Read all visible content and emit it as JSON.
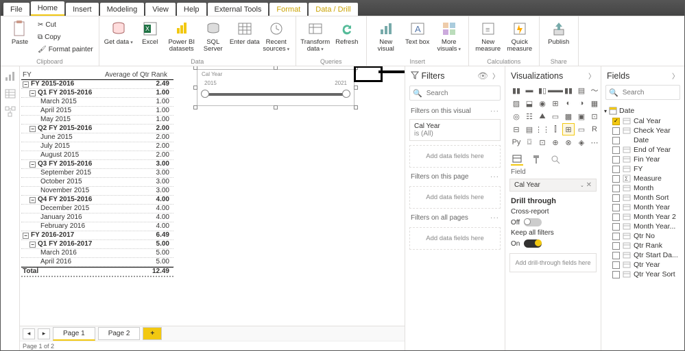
{
  "menu": {
    "file": "File",
    "home": "Home",
    "insert": "Insert",
    "modeling": "Modeling",
    "view": "View",
    "help": "Help",
    "ext": "External Tools",
    "format": "Format",
    "drill": "Data / Drill"
  },
  "ribbon": {
    "clipboard": {
      "paste": "Paste",
      "cut": "Cut",
      "copy": "Copy",
      "fp": "Format painter",
      "label": "Clipboard"
    },
    "data": {
      "get": "Get data",
      "excel": "Excel",
      "pbi": "Power BI datasets",
      "sql": "SQL Server",
      "enter": "Enter data",
      "recent": "Recent sources",
      "label": "Data"
    },
    "queries": {
      "transform": "Transform data",
      "refresh": "Refresh",
      "label": "Queries"
    },
    "insert": {
      "newv": "New visual",
      "text": "Text box",
      "more": "More visuals",
      "label": "Insert"
    },
    "calc": {
      "newm": "New measure",
      "quick": "Quick measure",
      "label": "Calculations"
    },
    "share": {
      "publish": "Publish",
      "label": "Share"
    }
  },
  "matrix": {
    "h1": "FY",
    "h2": "Average of Qtr Rank",
    "rows": [
      {
        "l": 0,
        "t": "FY 2015-2016",
        "v": "2.49",
        "e": "−"
      },
      {
        "l": 1,
        "t": "Q1 FY 2015-2016",
        "v": "1.00",
        "e": "−"
      },
      {
        "l": 2,
        "t": "March 2015",
        "v": "1.00"
      },
      {
        "l": 2,
        "t": "April 2015",
        "v": "1.00"
      },
      {
        "l": 2,
        "t": "May 2015",
        "v": "1.00"
      },
      {
        "l": 1,
        "t": "Q2 FY 2015-2016",
        "v": "2.00",
        "e": "−"
      },
      {
        "l": 2,
        "t": "June 2015",
        "v": "2.00"
      },
      {
        "l": 2,
        "t": "July 2015",
        "v": "2.00"
      },
      {
        "l": 2,
        "t": "August 2015",
        "v": "2.00"
      },
      {
        "l": 1,
        "t": "Q3 FY 2015-2016",
        "v": "3.00",
        "e": "−"
      },
      {
        "l": 2,
        "t": "September 2015",
        "v": "3.00"
      },
      {
        "l": 2,
        "t": "October 2015",
        "v": "3.00"
      },
      {
        "l": 2,
        "t": "November 2015",
        "v": "3.00"
      },
      {
        "l": 1,
        "t": "Q4 FY 2015-2016",
        "v": "4.00",
        "e": "−"
      },
      {
        "l": 2,
        "t": "December 2015",
        "v": "4.00"
      },
      {
        "l": 2,
        "t": "January 2016",
        "v": "4.00"
      },
      {
        "l": 2,
        "t": "February 2016",
        "v": "4.00"
      },
      {
        "l": 0,
        "t": "FY 2016-2017",
        "v": "6.49",
        "e": "−"
      },
      {
        "l": 1,
        "t": "Q1 FY 2016-2017",
        "v": "5.00",
        "e": "−"
      },
      {
        "l": 2,
        "t": "March 2016",
        "v": "5.00"
      },
      {
        "l": 2,
        "t": "April 2016",
        "v": "5.00"
      }
    ],
    "total": {
      "t": "Total",
      "v": "12.49"
    }
  },
  "slicer": {
    "title": "Cal Year",
    "min": "2015",
    "max": "2021"
  },
  "filters": {
    "title": "Filters",
    "search": "Search",
    "s1": "Filters on this visual",
    "card_f": "Cal Year",
    "card_v": "is (All)",
    "drop": "Add data fields here",
    "s2": "Filters on this page",
    "s3": "Filters on all pages"
  },
  "viz": {
    "title": "Visualizations",
    "wlabel": "Field",
    "wfield": "Cal Year",
    "dt": "Drill through",
    "cr": "Cross-report",
    "off": "Off",
    "kaf": "Keep all filters",
    "on": "On",
    "dtdrop": "Add drill-through fields here"
  },
  "fields": {
    "title": "Fields",
    "search": "Search",
    "table": "Date",
    "items": [
      {
        "n": "Cal Year",
        "ck": true,
        "ic": "h"
      },
      {
        "n": "Check Year",
        "ic": "h"
      },
      {
        "n": "Date"
      },
      {
        "n": "End of Year",
        "ic": "h"
      },
      {
        "n": "Fin Year",
        "ic": "h"
      },
      {
        "n": "FY",
        "ic": "h"
      },
      {
        "n": "Measure",
        "ic": "m"
      },
      {
        "n": "Month",
        "ic": "h"
      },
      {
        "n": "Month Sort",
        "ic": "h"
      },
      {
        "n": "Month Year",
        "ic": "h"
      },
      {
        "n": "Month Year 2",
        "ic": "h"
      },
      {
        "n": "Month Year...",
        "ic": "h"
      },
      {
        "n": "Qtr No",
        "ic": "h"
      },
      {
        "n": "Qtr Rank",
        "ic": "h"
      },
      {
        "n": "Qtr Start Da...",
        "ic": "h"
      },
      {
        "n": "Qtr Year",
        "ic": "h"
      },
      {
        "n": "Qtr Year Sort",
        "ic": "h"
      }
    ]
  },
  "pages": {
    "p1": "Page 1",
    "p2": "Page 2",
    "status": "Page 1 of 2"
  }
}
